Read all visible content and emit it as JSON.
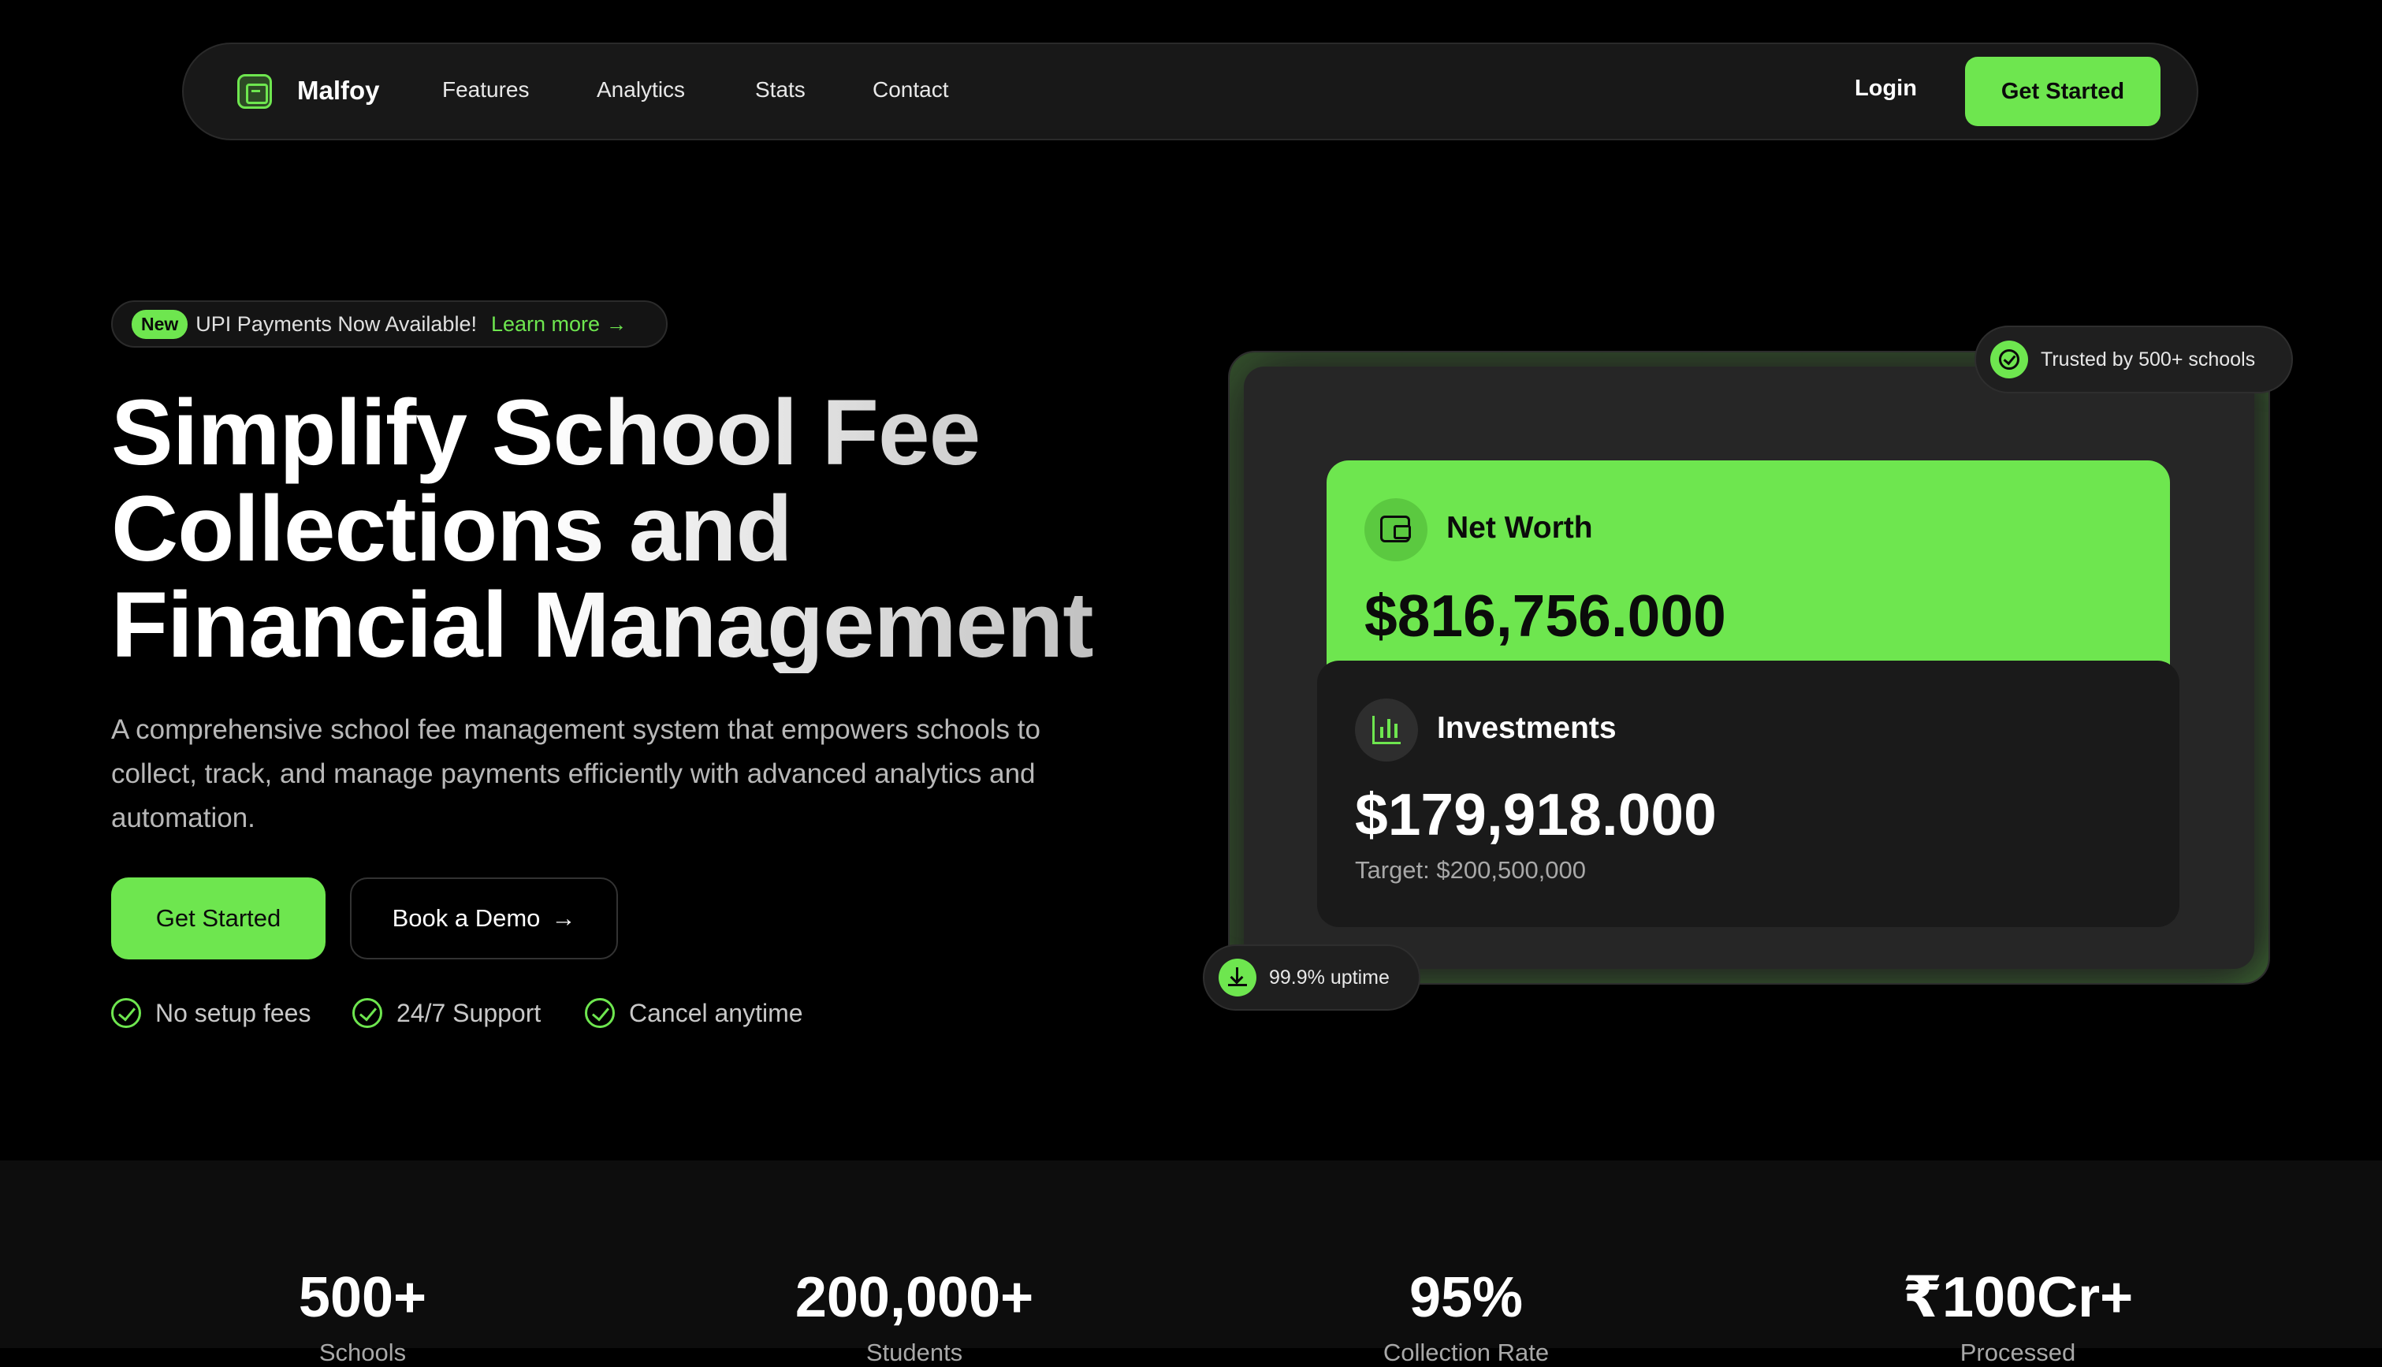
{
  "nav": {
    "brand": "Malfoy",
    "links": [
      "Features",
      "Analytics",
      "Stats",
      "Contact"
    ],
    "login": "Login",
    "cta": "Get Started"
  },
  "announcement": {
    "badge": "New",
    "text": "UPI Payments Now Available!",
    "link": "Learn more",
    "link_arrow": "→"
  },
  "hero": {
    "headline_lines": [
      "Simplify School Fee",
      "Collections and",
      "Financial Management"
    ],
    "subtext": "A comprehensive school fee management system that empowers schools to collect, track, and manage payments efficiently with advanced analytics and automation.",
    "primary_cta": "Get Started",
    "secondary_cta": "Book a Demo",
    "secondary_arrow": "→",
    "perks": [
      "No setup fees",
      "24/7 Support",
      "Cancel anytime"
    ]
  },
  "dashboard": {
    "trust_badge": "Trusted by 500+ schools",
    "uptime_badge": "99.9% uptime",
    "net_worth": {
      "title": "Net Worth",
      "value": "$816,756.000"
    },
    "investments": {
      "title": "Investments",
      "value": "$179,918.000",
      "target": "Target: $200,500,000"
    }
  },
  "stats": [
    {
      "value": "500+",
      "label": "Schools"
    },
    {
      "value": "200,000+",
      "label": "Students"
    },
    {
      "value": "95%",
      "label": "Collection Rate"
    },
    {
      "value": "₹100Cr+",
      "label": "Processed"
    }
  ],
  "colors": {
    "accent": "#6ee64f",
    "background": "#000000",
    "surface": "#181818"
  }
}
